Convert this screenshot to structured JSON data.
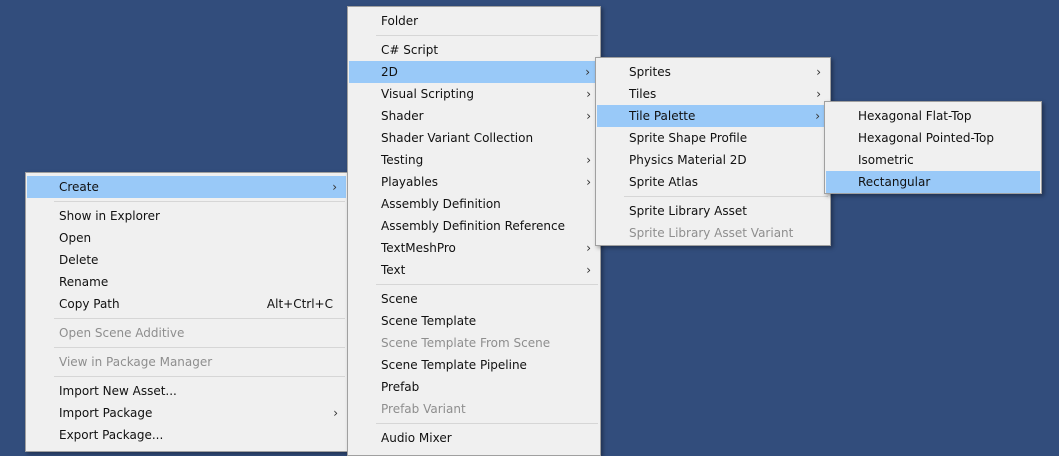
{
  "main_menu": {
    "create": "Create",
    "show_in_explorer": "Show in Explorer",
    "open": "Open",
    "delete": "Delete",
    "rename": "Rename",
    "copy_path": "Copy Path",
    "copy_path_shortcut": "Alt+Ctrl+C",
    "open_scene_additive": "Open Scene Additive",
    "view_in_package_manager": "View in Package Manager",
    "import_new_asset": "Import New Asset...",
    "import_package": "Import Package",
    "export_package": "Export Package..."
  },
  "create_menu": {
    "folder": "Folder",
    "csharp_script": "C# Script",
    "two_d": "2D",
    "visual_scripting": "Visual Scripting",
    "shader": "Shader",
    "shader_variant_collection": "Shader Variant Collection",
    "testing": "Testing",
    "playables": "Playables",
    "assembly_definition": "Assembly Definition",
    "assembly_definition_reference": "Assembly Definition Reference",
    "textmeshpro": "TextMeshPro",
    "text": "Text",
    "scene": "Scene",
    "scene_template": "Scene Template",
    "scene_template_from_scene": "Scene Template From Scene",
    "scene_template_pipeline": "Scene Template Pipeline",
    "prefab": "Prefab",
    "prefab_variant": "Prefab Variant",
    "audio_mixer": "Audio Mixer"
  },
  "twod_menu": {
    "sprites": "Sprites",
    "tiles": "Tiles",
    "tile_palette": "Tile Palette",
    "sprite_shape_profile": "Sprite Shape Profile",
    "physics_material_2d": "Physics Material 2D",
    "sprite_atlas": "Sprite Atlas",
    "sprite_library_asset": "Sprite Library Asset",
    "sprite_library_asset_variant": "Sprite Library Asset Variant"
  },
  "tile_palette_menu": {
    "hexagonal_flat_top": "Hexagonal Flat-Top",
    "hexagonal_pointed_top": "Hexagonal Pointed-Top",
    "isometric": "Isometric",
    "rectangular": "Rectangular"
  },
  "icons": {
    "submenu_arrow": "›"
  },
  "colors": {
    "desktop_bg": "#324d7c",
    "menu_bg": "#f0f0f0",
    "highlight": "#99c9f8",
    "disabled_text": "#8e8e8e"
  }
}
